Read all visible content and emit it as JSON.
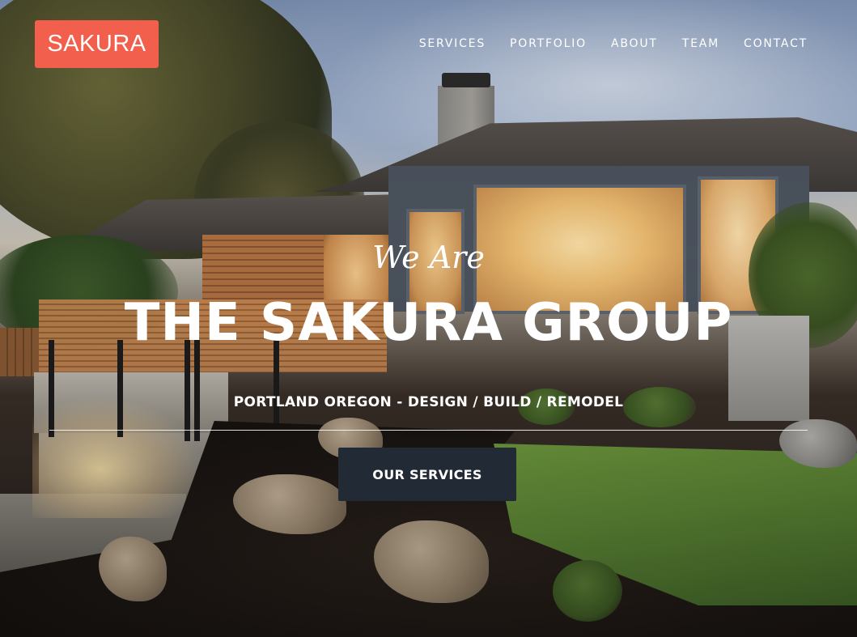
{
  "brand": {
    "logo_text": "SAKURA",
    "logo_color": "#f25f4c"
  },
  "nav": {
    "items": [
      {
        "label": "SERVICES"
      },
      {
        "label": "PORTFOLIO"
      },
      {
        "label": "ABOUT"
      },
      {
        "label": "TEAM"
      },
      {
        "label": "CONTACT"
      }
    ]
  },
  "hero": {
    "intro": "We Are",
    "headline": "THE SAKURA GROUP",
    "tagline": "PORTLAND OREGON - DESIGN / BUILD / REMODEL",
    "cta_label": "OUR SERVICES",
    "cta_color": "#222a35"
  }
}
